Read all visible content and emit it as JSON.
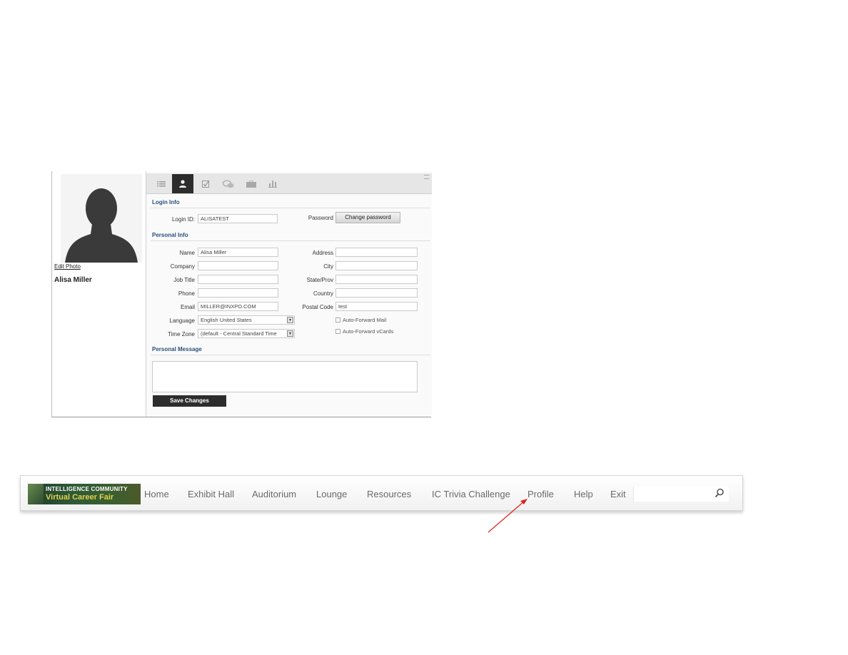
{
  "profile": {
    "edit_photo": "Edit Photo",
    "user_name": "Alisa Miller",
    "tabs": [
      {
        "icon": "list-icon"
      },
      {
        "icon": "user-icon",
        "active": true
      },
      {
        "icon": "checkbox-icon"
      },
      {
        "icon": "chat-icon"
      },
      {
        "icon": "briefcase-icon"
      },
      {
        "icon": "bar-chart-icon"
      }
    ],
    "login_info": {
      "title": "Login Info",
      "login_id_label": "Login ID:",
      "login_id_value": "ALISATEST",
      "password_label": "Password",
      "change_password_label": "Change password"
    },
    "personal_info": {
      "title": "Personal Info",
      "name_label": "Name",
      "name_value": "Alisa Miller",
      "company_label": "Company",
      "company_value": "",
      "job_title_label": "Job Title",
      "job_title_value": "",
      "phone_label": "Phone",
      "phone_value": "",
      "email_label": "Email",
      "email_value": "MILLER@INXPO.COM",
      "language_label": "Language",
      "language_value": "English United States",
      "time_zone_label": "Time Zone",
      "time_zone_value": "(default - Central Standard Time",
      "address_label": "Address",
      "address_value": "",
      "city_label": "City",
      "city_value": "",
      "state_label": "State/Prov",
      "state_value": "",
      "country_label": "Country",
      "country_value": "",
      "postal_label": "Postal Code",
      "postal_value": "test",
      "auto_forward_mail": "Auto-Forward Mail",
      "auto_forward_vcards": "Auto-Forward vCards"
    },
    "personal_message": {
      "title": "Personal Message",
      "value": ""
    },
    "save_label": "Save Changes"
  },
  "nav": {
    "logo_top": "INTELLIGENCE COMMUNITY",
    "logo_bottom": "Virtual Career Fair",
    "items": [
      "Home",
      "Exhibit Hall",
      "Auditorium",
      "Lounge",
      "Resources",
      "IC Trivia Challenge",
      "Profile",
      "Help",
      "Exit"
    ],
    "search_placeholder": ""
  },
  "colors": {
    "annotation_arrow": "#e02020",
    "section_title": "#2a4f7a",
    "active_tab": "#2c2c2c"
  }
}
